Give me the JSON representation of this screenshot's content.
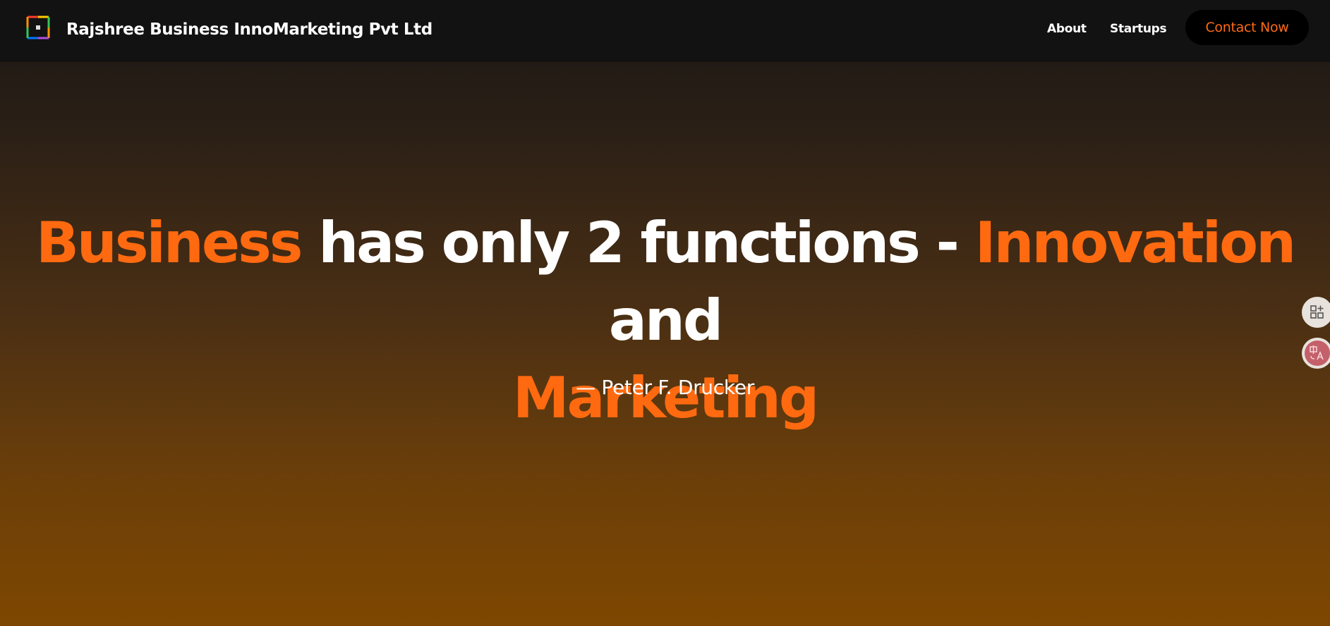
{
  "header": {
    "brand": "Rajshree Business InnoMarketing Pvt Ltd",
    "logo_icon": "colorful-square-logo",
    "nav": [
      {
        "label": "About"
      },
      {
        "label": "Startups"
      }
    ],
    "cta_label": "Contact Now"
  },
  "hero": {
    "headline": {
      "part1": "Business",
      "part2": " has only 2 functions - ",
      "part3": "Innovation",
      "part4": " and ",
      "part5": "Marketing"
    },
    "attribution": "— Peter F. Drucker"
  },
  "side_tools": {
    "apps_icon": "apps-add-icon",
    "translate_icon": "translate-icon"
  },
  "colors": {
    "accent": "#ff6a10",
    "nav_bg": "#121212",
    "text": "#ffffff",
    "gradient_bottom": "#7e4700"
  }
}
